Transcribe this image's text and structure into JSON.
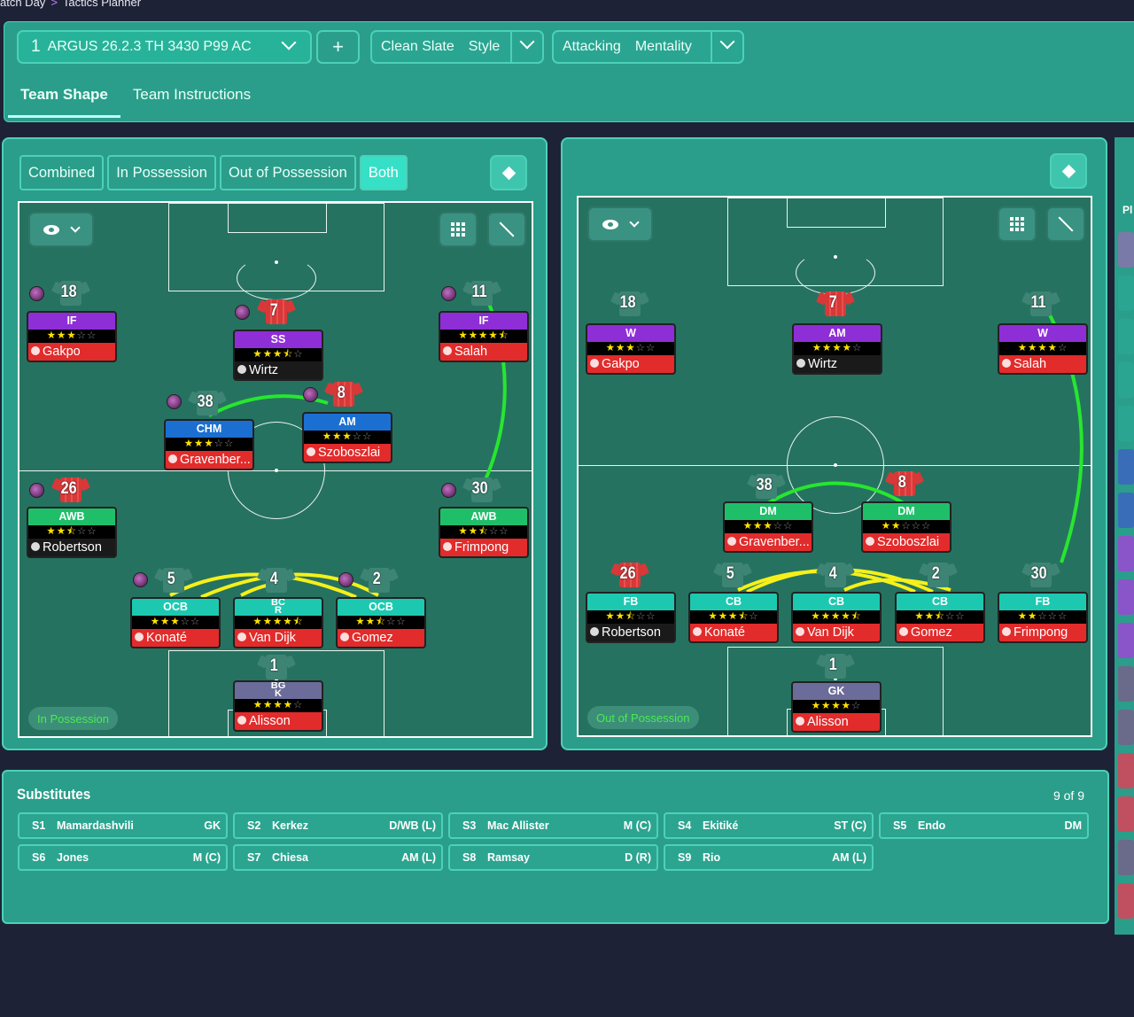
{
  "breadcrumb": [
    "atch Day",
    "Tactics Planner"
  ],
  "toolbar": {
    "tactic_number": "1",
    "tactic_name": "ARGUS 26.2.3 TH 3430 P99 AC",
    "add_label": "+",
    "style_value": "Clean Slate",
    "style_label": "Style",
    "mentality_value": "Attacking",
    "mentality_label": "Mentality"
  },
  "tabs": [
    "Team Shape",
    "Team Instructions"
  ],
  "left_panel": {
    "segments": [
      "Combined",
      "In Possession",
      "Out of Possession",
      "Both"
    ],
    "active_segment": "Both",
    "phase_pill": "In Possession",
    "players": [
      {
        "num": "18",
        "role": "IF",
        "rating": 3,
        "name": "Gakpo",
        "name_color": "red",
        "role_color": "purple"
      },
      {
        "num": "7",
        "role": "SS",
        "rating": 3.5,
        "name": "Wirtz",
        "name_color": "black",
        "role_color": "purple"
      },
      {
        "num": "11",
        "role": "IF",
        "rating": 4.5,
        "name": "Salah",
        "name_color": "red",
        "role_color": "purple"
      },
      {
        "num": "38",
        "role": "CHM",
        "rating": 3,
        "name": "Gravenber...",
        "name_color": "red",
        "role_color": "blue"
      },
      {
        "num": "8",
        "role": "AM",
        "rating": 3,
        "name": "Szoboszlai",
        "name_color": "red",
        "role_color": "blue"
      },
      {
        "num": "26",
        "role": "AWB",
        "rating": 2.5,
        "name": "Robertson",
        "name_color": "black",
        "role_color": "green"
      },
      {
        "num": "30",
        "role": "AWB",
        "rating": 2.5,
        "name": "Frimpong",
        "name_color": "red",
        "role_color": "green"
      },
      {
        "num": "5",
        "role": "OCB",
        "rating": 3,
        "name": "Konaté",
        "name_color": "red",
        "role_color": "teal"
      },
      {
        "num": "4",
        "role": "BC\nR",
        "rating": 4.5,
        "name": "Van Dijk",
        "name_color": "red",
        "role_color": "teal"
      },
      {
        "num": "2",
        "role": "OCB",
        "rating": 2.5,
        "name": "Gomez",
        "name_color": "red",
        "role_color": "teal"
      },
      {
        "num": "1",
        "role": "BG\nK",
        "rating": 4,
        "name": "Alisson",
        "name_color": "red",
        "role_color": "grey"
      }
    ]
  },
  "right_panel": {
    "phase_pill": "Out of Possession",
    "players": [
      {
        "num": "18",
        "role": "W",
        "rating": 3,
        "name": "Gakpo",
        "name_color": "red",
        "role_color": "purple"
      },
      {
        "num": "7",
        "role": "AM",
        "rating": 4,
        "name": "Wirtz",
        "name_color": "black",
        "role_color": "purple"
      },
      {
        "num": "11",
        "role": "W",
        "rating": 4,
        "name": "Salah",
        "name_color": "red",
        "role_color": "purple"
      },
      {
        "num": "38",
        "role": "DM",
        "rating": 3,
        "name": "Gravenber...",
        "name_color": "red",
        "role_color": "green"
      },
      {
        "num": "8",
        "role": "DM",
        "rating": 2,
        "name": "Szoboszlai",
        "name_color": "red",
        "role_color": "green"
      },
      {
        "num": "26",
        "role": "FB",
        "rating": 2.5,
        "name": "Robertson",
        "name_color": "black",
        "role_color": "teal"
      },
      {
        "num": "5",
        "role": "CB",
        "rating": 3.5,
        "name": "Konaté",
        "name_color": "red",
        "role_color": "teal"
      },
      {
        "num": "4",
        "role": "CB",
        "rating": 4.5,
        "name": "Van Dijk",
        "name_color": "red",
        "role_color": "teal"
      },
      {
        "num": "2",
        "role": "CB",
        "rating": 2.5,
        "name": "Gomez",
        "name_color": "red",
        "role_color": "teal"
      },
      {
        "num": "30",
        "role": "FB",
        "rating": 2,
        "name": "Frimpong",
        "name_color": "red",
        "role_color": "teal"
      },
      {
        "num": "1",
        "role": "GK",
        "rating": 4,
        "name": "Alisson",
        "name_color": "red",
        "role_color": "grey"
      }
    ]
  },
  "substitutes": {
    "title": "Substitutes",
    "count": "9 of 9",
    "items": [
      {
        "slot": "S1",
        "name": "Mamardashvili",
        "pos": "GK"
      },
      {
        "slot": "S2",
        "name": "Kerkez",
        "pos": "D/WB (L)"
      },
      {
        "slot": "S3",
        "name": "Mac Allister",
        "pos": "M (C)"
      },
      {
        "slot": "S4",
        "name": "Ekitiké",
        "pos": "ST (C)"
      },
      {
        "slot": "S5",
        "name": "Endo",
        "pos": "DM"
      },
      {
        "slot": "S6",
        "name": "Jones",
        "pos": "M (C)"
      },
      {
        "slot": "S7",
        "name": "Chiesa",
        "pos": "AM (L)"
      },
      {
        "slot": "S8",
        "name": "Ramsay",
        "pos": "D (R)"
      },
      {
        "slot": "S9",
        "name": "Rio",
        "pos": "AM (L)"
      }
    ]
  },
  "right_rail_label": "Pl",
  "colors": {
    "panel": "#2a9e8a",
    "border": "#4cd1b8",
    "pitch": "#267260",
    "link_green": "#27e62f",
    "link_yellow": "#f6f01a"
  }
}
